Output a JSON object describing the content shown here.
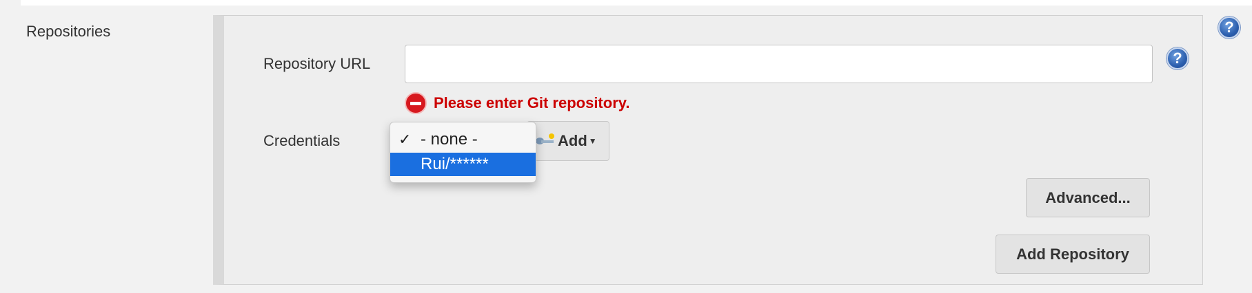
{
  "section": {
    "label": "Repositories"
  },
  "help": {
    "symbol": "?"
  },
  "repository_url": {
    "label": "Repository URL",
    "value": ""
  },
  "error": {
    "message": "Please enter Git repository."
  },
  "credentials": {
    "label": "Credentials",
    "add_label": "Add",
    "options": [
      {
        "label": "- none -",
        "checked": true
      },
      {
        "label": "Rui/******",
        "highlighted": true
      }
    ]
  },
  "buttons": {
    "advanced": "Advanced...",
    "add_repository": "Add Repository"
  },
  "colors": {
    "error": "#cc0000",
    "highlight": "#1a6fe0",
    "help_blue": "#2c5fae"
  }
}
